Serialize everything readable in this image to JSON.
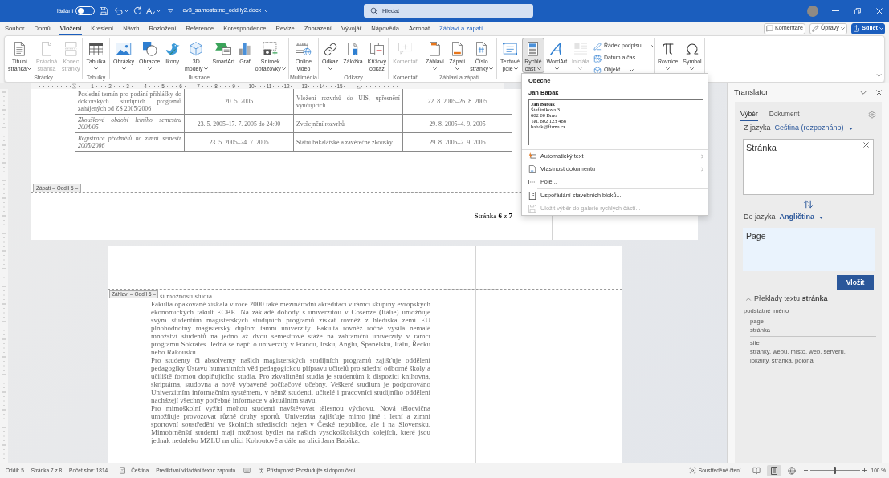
{
  "title_bar": {
    "autosave_label": "ládání",
    "autosave_on": false,
    "document_name": "cv3_samostatne_oddily2.docx",
    "search": {
      "placeholder": "Hledat"
    }
  },
  "menu_tabs": [
    {
      "label": "Soubor",
      "selected": false,
      "contextual": false
    },
    {
      "label": "Domů",
      "selected": false,
      "contextual": false
    },
    {
      "label": "Vložení",
      "selected": true,
      "contextual": false
    },
    {
      "label": "Kreslení",
      "selected": false,
      "contextual": false
    },
    {
      "label": "Návrh",
      "selected": false,
      "contextual": false
    },
    {
      "label": "Rozložení",
      "selected": false,
      "contextual": false
    },
    {
      "label": "Reference",
      "selected": false,
      "contextual": false
    },
    {
      "label": "Korespondence",
      "selected": false,
      "contextual": false
    },
    {
      "label": "Revize",
      "selected": false,
      "contextual": false
    },
    {
      "label": "Zobrazení",
      "selected": false,
      "contextual": false
    },
    {
      "label": "Vývojář",
      "selected": false,
      "contextual": false
    },
    {
      "label": "Nápověda",
      "selected": false,
      "contextual": false
    },
    {
      "label": "Acrobat",
      "selected": false,
      "contextual": false
    },
    {
      "label": "Záhlaví a zápatí",
      "selected": false,
      "contextual": true
    }
  ],
  "top_buttons": [
    {
      "label": "Komentáře",
      "primary": false,
      "dropdown": false
    },
    {
      "label": "Úpravy",
      "primary": false,
      "dropdown": true
    },
    {
      "label": "Sdílet",
      "primary": true,
      "dropdown": true
    }
  ],
  "ribbon": {
    "groups": [
      {
        "label": "Stránky",
        "buttons": [
          {
            "label": "Titulní\nstránka",
            "dropdown": true,
            "disabled": false,
            "pressed": false
          },
          {
            "label": "Prázdná\nstránka",
            "dropdown": false,
            "disabled": true,
            "pressed": false
          },
          {
            "label": "Konec\nstránky",
            "dropdown": false,
            "disabled": true,
            "pressed": false
          }
        ]
      },
      {
        "label": "Tabulky",
        "buttons": [
          {
            "label": "Tabulka",
            "dropdown": true,
            "disabled": false,
            "pressed": false
          }
        ]
      },
      {
        "label": "Ilustrace",
        "buttons": [
          {
            "label": "Obrázky",
            "dropdown": true,
            "disabled": false,
            "pressed": false
          },
          {
            "label": "Obrazce",
            "dropdown": true,
            "disabled": false,
            "pressed": false
          },
          {
            "label": "Ikony",
            "dropdown": false,
            "disabled": false,
            "pressed": false
          },
          {
            "label": "3D\nmodely",
            "dropdown": true,
            "disabled": false,
            "pressed": false
          },
          {
            "label": "SmartArt",
            "dropdown": false,
            "disabled": false,
            "pressed": false
          },
          {
            "label": "Graf",
            "dropdown": false,
            "disabled": false,
            "pressed": false
          },
          {
            "label": "Snímek\nobrazovky",
            "dropdown": true,
            "disabled": false,
            "pressed": false
          }
        ]
      },
      {
        "label": "Multimédia",
        "buttons": [
          {
            "label": "Online\nvideo",
            "dropdown": false,
            "disabled": false,
            "pressed": false
          }
        ]
      },
      {
        "label": "Odkazy",
        "buttons": [
          {
            "label": "Odkaz",
            "dropdown": true,
            "disabled": false,
            "pressed": false
          },
          {
            "label": "Záložka",
            "dropdown": false,
            "disabled": false,
            "pressed": false
          },
          {
            "label": "Křížový\nodkaz",
            "dropdown": false,
            "disabled": false,
            "pressed": false
          }
        ]
      },
      {
        "label": "Komentář",
        "buttons": [
          {
            "label": "Komentář",
            "dropdown": false,
            "disabled": true,
            "pressed": false
          }
        ]
      },
      {
        "label": "Záhlaví a zápatí",
        "buttons": [
          {
            "label": "Záhlaví",
            "dropdown": true,
            "disabled": false,
            "pressed": false
          },
          {
            "label": "Zápatí",
            "dropdown": true,
            "disabled": false,
            "pressed": false
          },
          {
            "label": "Číslo\nstránky",
            "dropdown": true,
            "disabled": false,
            "pressed": false
          }
        ]
      },
      {
        "buttons": [
          {
            "label": "Textové\npole",
            "dropdown": true,
            "disabled": false,
            "pressed": false
          },
          {
            "label": "Rychlé\nčásti",
            "dropdown": true,
            "disabled": false,
            "pressed": true
          },
          {
            "label": "WordArt",
            "dropdown": true,
            "disabled": false,
            "pressed": false
          },
          {
            "label": "Iniciála",
            "dropdown": true,
            "disabled": true,
            "pressed": false
          }
        ],
        "small_buttons": [
          {
            "label": "Řádek podpisu",
            "dropdown": true
          },
          {
            "label": "Datum a čas",
            "dropdown": false
          },
          {
            "label": "Objekt",
            "dropdown": true
          }
        ]
      },
      {
        "buttons": [
          {
            "label": "Rovnice",
            "dropdown": true,
            "disabled": false,
            "pressed": false
          },
          {
            "label": "Symbol",
            "dropdown": true,
            "disabled": false,
            "pressed": false
          }
        ]
      }
    ]
  },
  "ruler": {
    "numbers": [
      "1",
      "2",
      "3",
      "4",
      "5",
      "6",
      "7",
      "8",
      "9",
      "10",
      "11",
      "12",
      "13",
      "14",
      "15"
    ]
  },
  "page_1": {
    "table": {
      "rows": [
        [
          {
            "text": "Poslední termín pro podání přihlášky do doktorských studijních programů zahájených od ZS 2005/2006",
            "italic": false
          },
          {
            "text": "20. 5. 2005",
            "italic": false
          },
          {
            "text": "Vložení rozvrhů do UIS, upřesnění vyučujících",
            "italic": false
          },
          {
            "text": "22. 8. 2005–26. 8. 2005",
            "italic": false
          }
        ],
        [
          {
            "text": "Zkouškové období letního semestru 2004/05",
            "italic": true
          },
          {
            "text": "23. 5. 2005–17. 7. 2005 do 24:00",
            "italic": false
          },
          {
            "text": "Zveřejnění rozvrhů",
            "italic": false
          },
          {
            "text": "29. 8. 2005–4. 9. 2005",
            "italic": false
          }
        ],
        [
          {
            "text": "Registrace předmětů na zimní semestr 2005/2006",
            "italic": true
          },
          {
            "text": "23. 5. 2005–24. 7. 2005",
            "italic": false
          },
          {
            "text": "Státní bakalářské a závěrečné zkoušky",
            "italic": false
          },
          {
            "text": "29. 8. 2005–2. 9. 2005",
            "italic": false
          }
        ]
      ]
    },
    "footer_tag": "Zápatí – Oddíl 5 –",
    "footer_text": "Stránka **6** z **7**"
  },
  "page_2": {
    "header_tag": "Záhlaví – Oddíl 6 –",
    "first_line": "ší možnosti studia",
    "paragraphs": [
      "Fakulta opakovaně získala v roce 2000 také mezinárodní akreditaci v rámci skupiny evropských ekonomických fakult ECBE. Na základě dohody s univerzitou v Cosenze (Itálie) umožňuje svým studentům magisterských studijních programů získat rovněž z hlediska zemí EU plnohodnotný magisterský diplom tamní univerzity. Fakulta rovněž ročně vysílá nemalé množství studentů na jedno až dvou semestrové stáže na zahraniční univerzity v rámci programu Sokrates. Jedná se např. o univerzity v Francii, Irsku, Anglii, Španělsku, Itálii, Řecku nebo Rakousku.",
      "Pro studenty či absolventy našich magisterských studijních programů zajišťuje oddělení pedagogiky Ústavu humanitních věd pedagogickou přípravu učitelů pro střední odborné školy a učiliště formou doplňujícího studia. Pro zkvalitnění studia je studentům k dispozici knihovna, skriptárna, studovna a nově vybavené počítačové učebny. Veškeré studium je podporováno Univerzitním informačním systémem, v němž studenti, učitelé i pracovníci studijního oddělení nacházejí všechny potřebné informace v aktuálním stavu.",
      "Pro mimoškolní vyžití mohou studenti navštěvovat tělesnou výchovu. Nová tělocvična umožňuje provozovat různé druhy sportů. Univerzita zajišťuje mimo jiné i letní a zimní sportovní soustředění ve školních střediscích nejen v České republice, ale i na Slovensku. Mimobrněnští studenti mají možnost bydlet na našich vysokoškolských kolejích, které jsou jednak nedaleko MZLU na ulici Kohoutově a dále na ulici Jana Babáka."
    ]
  },
  "quick_parts_menu": {
    "section": "Obecné",
    "entry": "Jan Babák",
    "preview": [
      "Jan Babák",
      "Štefánikova 3",
      "602 00 Brno",
      "Tel. 602 123 468",
      "babak@firma.cz"
    ],
    "item_groups": [
      [
        {
          "label": "Automatický text",
          "submenu": true,
          "disabled": false
        },
        {
          "label": "Vlastnost dokumentu",
          "submenu": true,
          "disabled": false
        },
        {
          "label": "Pole...",
          "submenu": false,
          "disabled": false
        }
      ],
      [
        {
          "label": "Uspořádání stavebních bloků...",
          "submenu": false,
          "disabled": false
        },
        {
          "label": "Uložit výběr do galerie rychlých částí...",
          "submenu": false,
          "disabled": true
        }
      ]
    ]
  },
  "translator": {
    "title": "Translator",
    "tabs": [
      {
        "label": "Výběr",
        "selected": true
      },
      {
        "label": "Dokument",
        "selected": false
      }
    ],
    "from_label": "Z jazyka",
    "from_language": "Čeština (rozpoznáno)",
    "source_text": "Stránka",
    "to_label": "Do jazyka",
    "to_language": "Angličtina",
    "translated_text": "Page",
    "insert_button": "Vložit",
    "translations_heading": "Překlady textu **stránka**",
    "part_of_speech": "podstatné jméno",
    "senses": [
      {
        "term": "page",
        "back_translations": "stránka"
      },
      {
        "term": "site",
        "back_translations": "stránky, webu, místo, web, serveru, lokality, stránka, poloha"
      }
    ]
  },
  "status_bar": {
    "section": "Oddíl: 5",
    "page": "Stránka 7 z 8",
    "word_count": "Počet slov: 1814",
    "language": "Čeština",
    "predictive_text": "Prediktivní vkládání textu: zapnuto",
    "accessibility": "Přístupnost: Prostudujte si doporučení",
    "focus": "Soustředěné čtení",
    "views": [
      {
        "selected": false
      },
      {
        "selected": true
      },
      {
        "selected": false
      }
    ],
    "zoom": {
      "level": 0.5,
      "reading": "100 %"
    }
  }
}
